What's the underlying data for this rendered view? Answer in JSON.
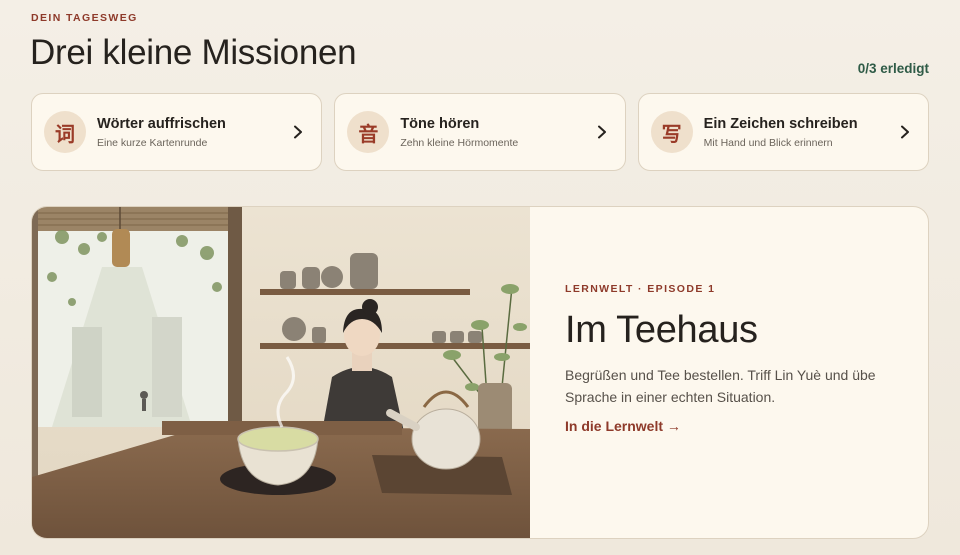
{
  "header": {
    "eyebrow": "DEIN TAGESWEG",
    "title": "Drei kleine Missionen",
    "progress": "0/3 erledigt"
  },
  "missions": [
    {
      "glyph": "词",
      "title": "Wörter auffrischen",
      "subtitle": "Eine kurze Kartenrunde",
      "icon": "chevron-right-icon"
    },
    {
      "glyph": "音",
      "title": "Töne hören",
      "subtitle": "Zehn kleine Hörmomente",
      "icon": "chevron-right-icon"
    },
    {
      "glyph": "写",
      "title": "Ein Zeichen schreiben",
      "subtitle": "Mit Hand und Blick erinnern",
      "icon": "chevron-right-icon"
    }
  ],
  "episode": {
    "eyebrow": "LERNWELT · EPISODE 1",
    "title": "Im Teehaus",
    "description": "Begrüßen und Tee bestellen. Triff Lin Yuè und übe Sprache in einer echten Situation.",
    "link": "In die Lernwelt →"
  },
  "colors": {
    "accent": "#8e3a2a",
    "success": "#2f5b47",
    "card_bg": "#fdf8ee",
    "border": "#ddd2c0"
  }
}
